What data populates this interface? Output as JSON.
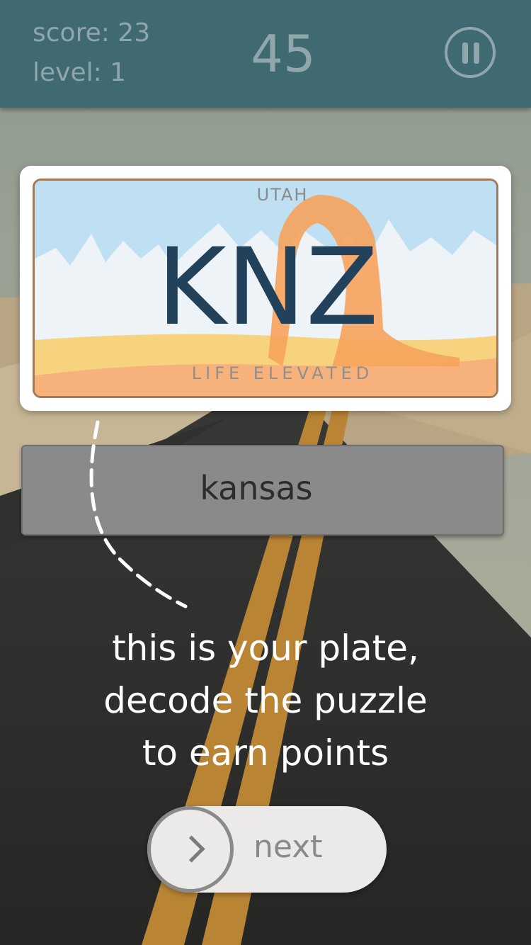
{
  "header": {
    "score": "score: 23",
    "level": "level: 1",
    "timer": "45"
  },
  "plate": {
    "state": "UTAH",
    "number": "KNZ",
    "slogan": "LIFE ELEVATED"
  },
  "answer": {
    "value": "kansas"
  },
  "tip": {
    "lines": [
      "this is your plate,",
      "decode the puzzle",
      "to earn points"
    ]
  },
  "next": {
    "label": "next"
  },
  "icons": {
    "pause": "pause-icon",
    "next": "chevron-right-icon"
  },
  "colors": {
    "header": "#3f6a72",
    "plate_text": "#22425c",
    "sand": "#f5c26b",
    "arch": "#f6a35c"
  }
}
